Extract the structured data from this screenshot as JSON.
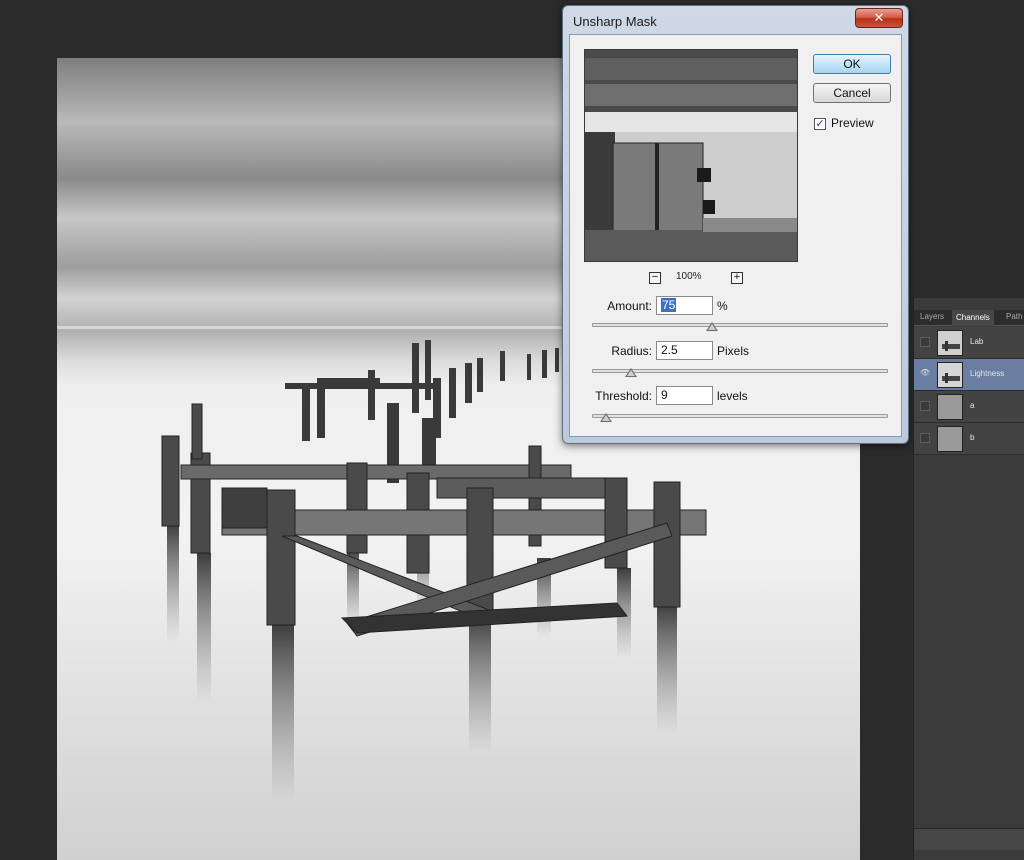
{
  "dialog": {
    "title": "Unsharp Mask",
    "ok_label": "OK",
    "cancel_label": "Cancel",
    "preview_label": "Preview",
    "preview_checked": true,
    "zoom_level": "100%",
    "amount": {
      "label": "Amount:",
      "value": "75",
      "unit": "%",
      "level": 0.4
    },
    "radius": {
      "label": "Radius:",
      "value": "2.5",
      "unit": "Pixels",
      "level": 0.13
    },
    "threshold": {
      "label": "Threshold:",
      "value": "9",
      "unit": "levels",
      "level": 0.04
    }
  },
  "panel": {
    "tabs": [
      "Layers",
      "Channels",
      "Path"
    ],
    "active_tab": "Channels",
    "channels": [
      {
        "name": "Lab",
        "visible": false,
        "selected": false
      },
      {
        "name": "Lightness",
        "visible": true,
        "selected": true
      },
      {
        "name": "a",
        "visible": false,
        "selected": false
      },
      {
        "name": "b",
        "visible": false,
        "selected": false
      }
    ]
  },
  "colors": {
    "dialog_frame": "#bccadb",
    "close_button": "#c6533b",
    "selected_channel": "#6a7ea2",
    "workspace": "#2b2b2b"
  }
}
